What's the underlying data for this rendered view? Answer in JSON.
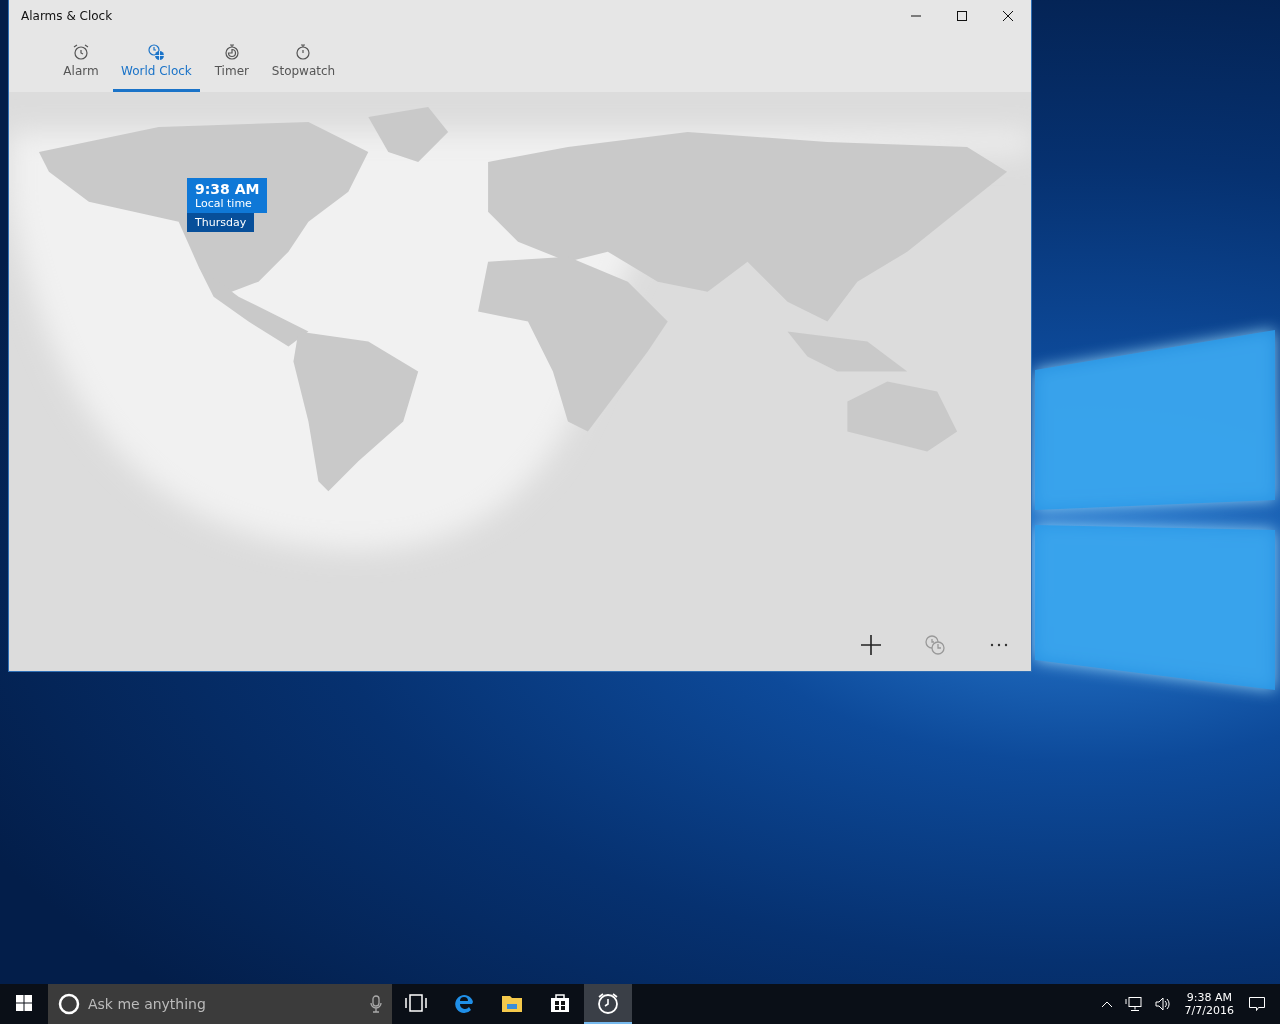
{
  "window": {
    "title": "Alarms & Clock"
  },
  "tabs": [
    {
      "label": "Alarm",
      "kind": "alarm",
      "selected": false
    },
    {
      "label": "World Clock",
      "kind": "world",
      "selected": true
    },
    {
      "label": "Timer",
      "kind": "timer",
      "selected": false
    },
    {
      "label": "Stopwatch",
      "kind": "stopwatch",
      "selected": false
    }
  ],
  "map_pin": {
    "time": "9:38 AM",
    "label": "Local time",
    "day": "Thursday"
  },
  "taskbar": {
    "search": {
      "placeholder": "Ask me anything"
    },
    "apps": [
      {
        "kind": "taskview",
        "selected": false
      },
      {
        "kind": "browser",
        "selected": false
      },
      {
        "kind": "folder",
        "selected": false
      },
      {
        "kind": "store",
        "selected": false
      },
      {
        "kind": "clock",
        "selected": true
      }
    ],
    "clock": {
      "time": "9:38 AM",
      "date": "7/7/2016"
    }
  }
}
